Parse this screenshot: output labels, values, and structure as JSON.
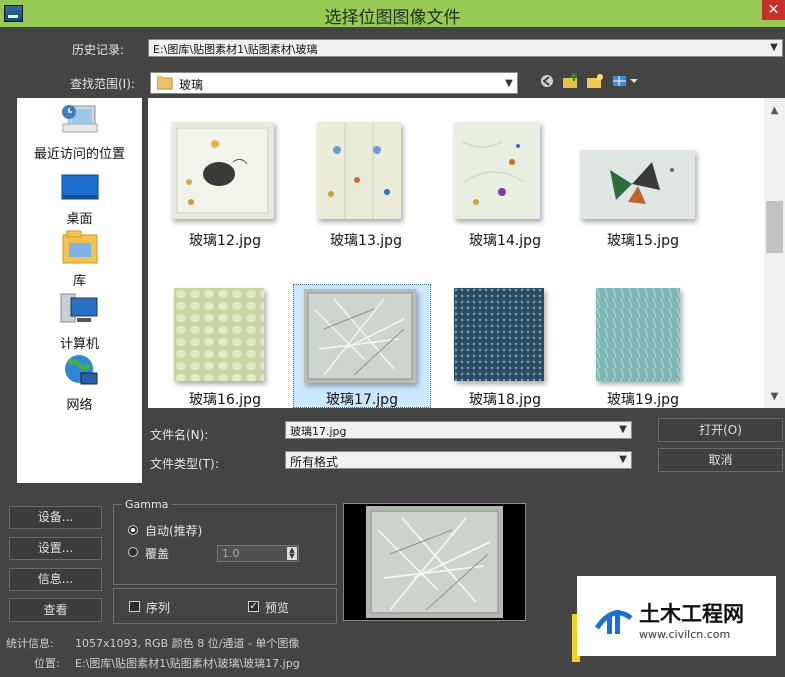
{
  "window": {
    "title": "选择位图图像文件",
    "close": "✕"
  },
  "history": {
    "label": "历史记录:",
    "value": "E:\\图库\\贴图素材1\\贴图素材\\玻璃"
  },
  "lookin": {
    "label": "查找范围(I):",
    "value": "玻璃"
  },
  "toolbar": {
    "icons": [
      "back-icon",
      "up-folder-icon",
      "new-folder-icon",
      "view-menu-icon"
    ]
  },
  "places": [
    {
      "label": "最近访问的位置",
      "icon": "recent-places-icon"
    },
    {
      "label": "桌面",
      "icon": "desktop-icon"
    },
    {
      "label": "库",
      "icon": "libraries-icon"
    },
    {
      "label": "计算机",
      "icon": "computer-icon"
    },
    {
      "label": "网络",
      "icon": "network-icon"
    }
  ],
  "files": [
    {
      "name": "玻璃12.jpg"
    },
    {
      "name": "玻璃13.jpg"
    },
    {
      "name": "玻璃14.jpg"
    },
    {
      "name": "玻璃15.jpg"
    },
    {
      "name": "玻璃16.jpg"
    },
    {
      "name": "玻璃17.jpg",
      "selected": true
    },
    {
      "name": "玻璃18.jpg"
    },
    {
      "name": "玻璃19.jpg"
    }
  ],
  "filename": {
    "label": "文件名(N):",
    "value": "玻璃17.jpg"
  },
  "filetype": {
    "label": "文件类型(T):",
    "value": "所有格式"
  },
  "buttons": {
    "open": "打开(O)",
    "cancel": "取消",
    "setup": "设备...",
    "settings": "设置...",
    "info": "信息...",
    "view": "查看"
  },
  "gamma": {
    "title": "Gamma",
    "auto": "自动(推荐)",
    "override": "覆盖",
    "override_value": "1.0"
  },
  "options": {
    "sequence": "序列",
    "preview": "预览",
    "sequence_checked": false,
    "preview_checked": true
  },
  "stats": {
    "label": "统计信息:",
    "value": "1057x1093, RGB 颜色 8 位/通道 - 单个图像",
    "location_label": "位置:",
    "location_value": "E:\\图库\\贴图素材1\\贴图素材\\玻璃\\玻璃17.jpg"
  },
  "watermark": {
    "brand": "土木工程网",
    "url": "www.civilcn.com"
  },
  "colors": {
    "titlebar": "#97c955",
    "dialog": "#444444",
    "selection": "#cce8ff"
  }
}
